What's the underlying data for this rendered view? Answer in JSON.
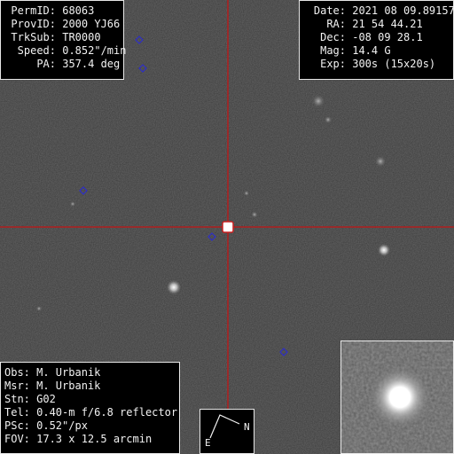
{
  "target_info": {
    "rows": [
      {
        "label": "PermID:",
        "value": "68063"
      },
      {
        "label": "ProvID:",
        "value": "2000 YJ66"
      },
      {
        "label": "TrkSub:",
        "value": "TR0000"
      },
      {
        "label": "Speed:",
        "value": "0.852\"/min"
      },
      {
        "label": "PA:",
        "value": "357.4 deg"
      }
    ]
  },
  "observation_info": {
    "rows": [
      {
        "label": "Date:",
        "value": "2021 08 09.89157"
      },
      {
        "label": "RA:",
        "value": "21 54 44.21"
      },
      {
        "label": "Dec:",
        "value": "-08 09 28.1"
      },
      {
        "label": "Mag:",
        "value": "14.4 G"
      },
      {
        "label": "Exp:",
        "value": "300s (15x20s)"
      }
    ]
  },
  "station_info": {
    "rows": [
      "Obs: M. Urbanik",
      "Msr: M. Urbanik",
      "Stn: G02",
      "Tel: 0.40-m f/6.8 reflector",
      "PSc: 0.52\"/px",
      "FOV: 17.3 x 12.5 arcmin"
    ]
  },
  "compass": {
    "north_label": "N",
    "east_label": "E"
  },
  "colors": {
    "sky_background": "#3a3a3a",
    "crosshair": "#b01e1e",
    "field_marker": "#2e2ec8",
    "panel_background": "#000000",
    "panel_text": "#f2f2f2",
    "panel_border": "#e8e8e8"
  },
  "icons": {
    "crosshair": "red-crosshair-icon",
    "field_marker": "blue-diamond-icon",
    "compass": "north-east-compass-icon"
  }
}
